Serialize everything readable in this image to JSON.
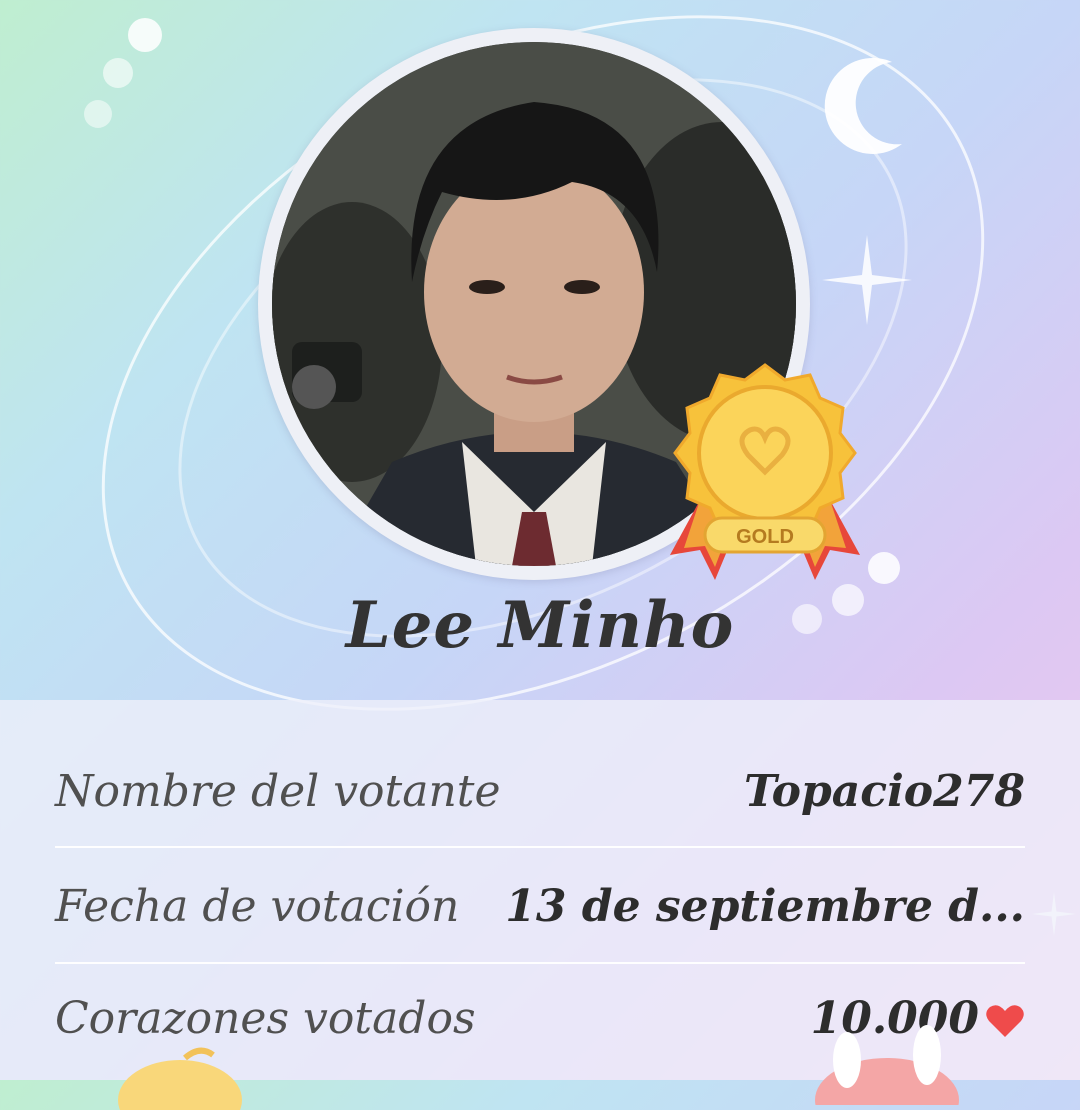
{
  "card": {
    "name": "Lee Minho",
    "badge_label": "GOLD"
  },
  "info": {
    "rows": [
      {
        "label": "Nombre del votante",
        "value": "Topacio278"
      },
      {
        "label": "Fecha de votación",
        "value": "13 de septiembre d..."
      },
      {
        "label": "Corazones votados",
        "value": "10.000"
      }
    ]
  },
  "icons": {
    "moon": "moon-icon",
    "star": "sparkle-star-icon",
    "medal": "gold-medal-icon",
    "heart": "heart-icon"
  },
  "colors": {
    "heart": "#ef4b4b",
    "medal_gold": "#f7c23b",
    "ribbon_red": "#e7473a"
  }
}
